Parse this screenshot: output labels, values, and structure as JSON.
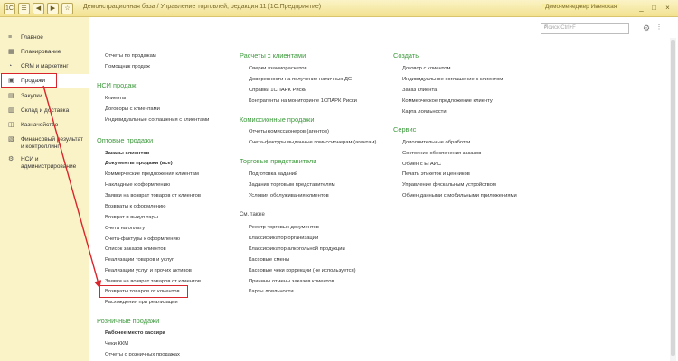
{
  "window": {
    "title": "Демонстрационная база / Управление торговлей, редакция 11 (1С:Предприятие)",
    "user": "Демо-менеджер Ивенская",
    "controls": [
      "_",
      "□",
      "×"
    ]
  },
  "titlebar_icons": [
    "☰",
    "◀",
    "▶",
    "☆"
  ],
  "sidebar": [
    {
      "label": "Главное",
      "icon": "menu-icon"
    },
    {
      "label": "Планирование",
      "icon": "calendar-icon"
    },
    {
      "label": "CRM и маркетинг",
      "icon": "crm-icon"
    },
    {
      "label": "Продажи",
      "icon": "cart-icon",
      "active": true
    },
    {
      "label": "Закупки",
      "icon": "purchase-icon"
    },
    {
      "label": "Склад и доставка",
      "icon": "warehouse-icon"
    },
    {
      "label": "Казначейство",
      "icon": "treasury-icon"
    },
    {
      "label": "Финансовый результат и контроллинг",
      "icon": "finance-icon"
    },
    {
      "label": "НСИ и администрирование",
      "icon": "settings-icon"
    }
  ],
  "search": {
    "placeholder": "Поиск Ctrl+F"
  },
  "col1": {
    "top_links": [
      "Отчеты по продажам",
      "Помощник продаж"
    ],
    "nsi_title": "НСИ продаж",
    "nsi_links": [
      "Клиенты",
      "Договоры с клиентами",
      "Индивидуальные соглашения с клиентами"
    ],
    "wholesale_title": "Оптовые продажи",
    "wholesale_links": [
      "Заказы клиентов",
      "Документы продажи (все)",
      "Коммерческие предложения клиентам",
      "Накладные к оформлению",
      "Заявки на возврат товаров от клиентов",
      "Возвраты к оформлению",
      "Возврат и выкуп тары",
      "Счета на оплату",
      "Счета-фактуры к оформлению",
      "Список заказов клиентов",
      "Реализации товаров и услуг",
      "Реализации услуг и прочих активов",
      "Заявки на возврат товаров от клиентов",
      "Возвраты товаров от клиентов",
      "Расхождения при реализации"
    ],
    "retail_title": "Розничные продажи",
    "retail_links": [
      "Рабочее место кассира",
      "Чеки ККМ",
      "Отчеты о розничных продажах"
    ]
  },
  "col2": {
    "settlements_title": "Расчеты с клиентами",
    "settlements_links": [
      "Сверки взаиморасчетов",
      "Доверенности на получение наличных ДС",
      "Справки 1СПАРК Риски",
      "Контрагенты на мониторинге 1СПАРК Риски"
    ],
    "commission_title": "Комиссионные продажи",
    "commission_links": [
      "Отчеты комиссионеров (агентов)",
      "Счета-фактуры выданные комиссионерам (агентам)"
    ],
    "agents_title": "Торговые представители",
    "agents_links": [
      "Подготовка заданий",
      "Задания торговым представителям",
      "Условия обслуживания клиентов"
    ],
    "see_also": "См. также",
    "see_links": [
      "Реестр торговых документов",
      "Классификатор организаций",
      "Классификатор алкогольной продукции",
      "Кассовые смены",
      "Кассовые чеки коррекции (не используется)",
      "Причины отмены заказов клиентов",
      "Карты лояльности"
    ]
  },
  "col3": {
    "create_title": "Создать",
    "create_links": [
      "Договор с клиентом",
      "Индивидуальное соглашение с клиентом",
      "Заказ клиента",
      "Коммерческое предложение клиенту",
      "Карта лояльности"
    ],
    "service_title": "Сервис",
    "service_links": [
      "Дополнительные обработки",
      "Состояние обеспечения заказов",
      "Обмен с ЕГАИС",
      "Печать этикеток и ценников",
      "Управление фискальным устройством",
      "Обмен данными с мобильными приложениями"
    ]
  },
  "colors": {
    "accent": "#3d9a3d",
    "highlight": "#d9262c",
    "sidebar_bg": "#fbf3c8"
  }
}
